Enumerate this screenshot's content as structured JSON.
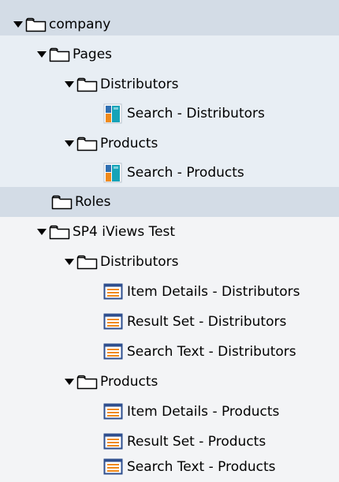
{
  "tree": {
    "nodes": [
      {
        "label": "company",
        "icon": "folder-icon",
        "state": "expanded"
      },
      {
        "label": "Pages",
        "icon": "folder-icon",
        "state": "expanded"
      },
      {
        "label": "Distributors",
        "icon": "folder-icon",
        "state": "expanded"
      },
      {
        "label": "Search - Distributors",
        "icon": "page-icon"
      },
      {
        "label": "Products",
        "icon": "folder-icon",
        "state": "expanded"
      },
      {
        "label": "Search - Products",
        "icon": "page-icon"
      },
      {
        "label": "Roles",
        "icon": "folder-icon",
        "state": "collapsed"
      },
      {
        "label": "SP4 iViews Test",
        "icon": "folder-icon",
        "state": "expanded"
      },
      {
        "label": "Distributors",
        "icon": "folder-icon",
        "state": "expanded"
      },
      {
        "label": "Item Details - Distributors",
        "icon": "iview-icon"
      },
      {
        "label": "Result Set - Distributors",
        "icon": "iview-icon"
      },
      {
        "label": "Search Text - Distributors",
        "icon": "iview-icon"
      },
      {
        "label": "Products",
        "icon": "folder-icon",
        "state": "expanded"
      },
      {
        "label": "Item Details - Products",
        "icon": "iview-icon"
      },
      {
        "label": "Result Set - Products",
        "icon": "iview-icon"
      },
      {
        "label": "Search Text - Products",
        "icon": "iview-icon"
      }
    ]
  },
  "colors": {
    "band_dark": "#d3dce6",
    "band_light": "#e8eef4",
    "band_gray": "#f3f4f6",
    "folder_outline": "#000000",
    "arrow": "#000000",
    "page_icon_blue": "#2f6fb2",
    "page_icon_orange": "#f08a1c",
    "page_icon_teal": "#16a3b8",
    "iview_icon_border": "#2f4f8f",
    "iview_icon_lines": "#f08a1c"
  }
}
